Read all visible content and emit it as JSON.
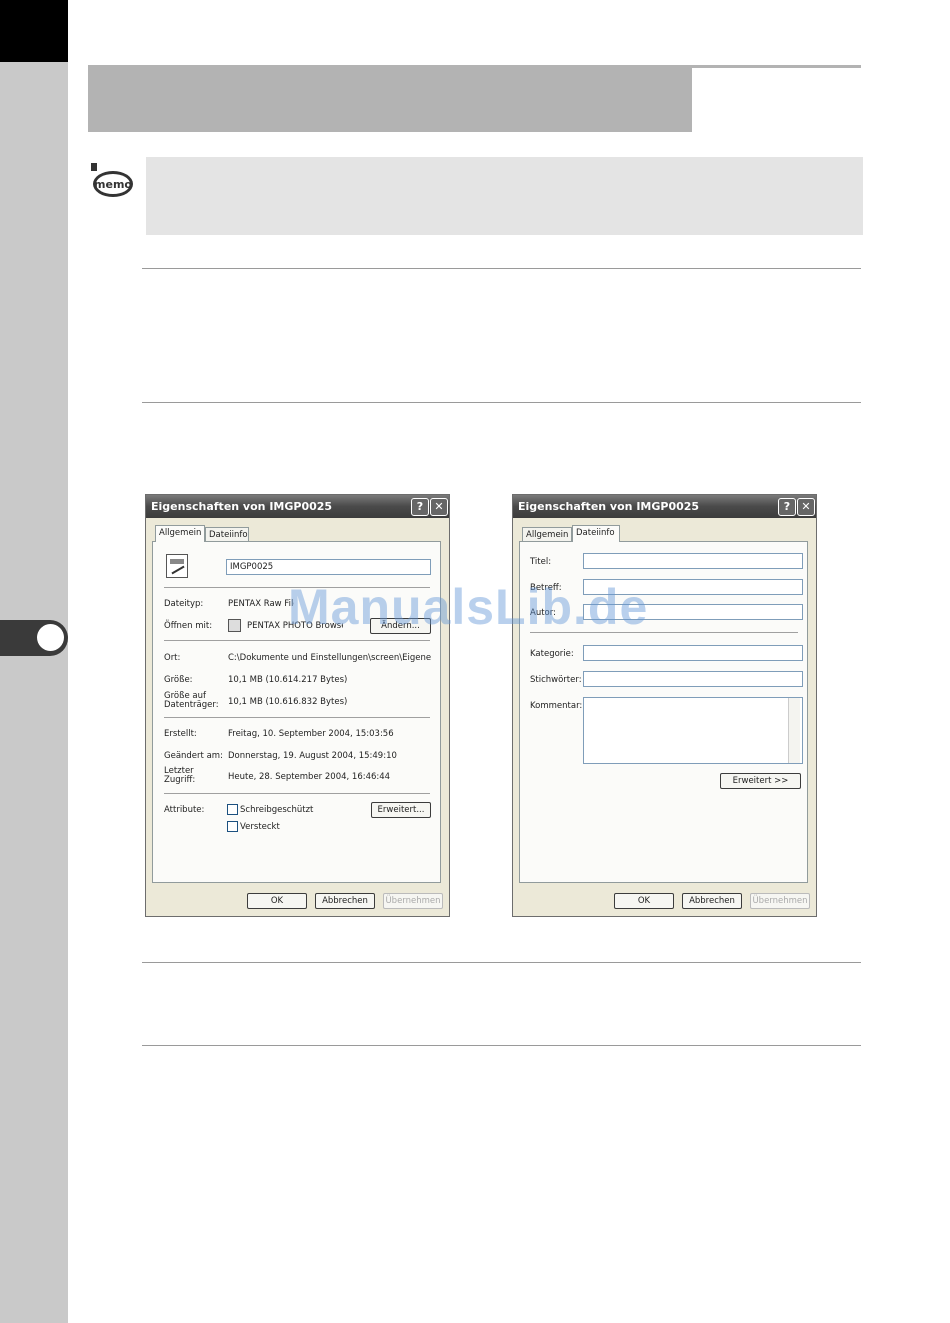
{
  "watermark": "ManualsLib.de",
  "memo": {
    "icon_text": "memo"
  },
  "dialog_left": {
    "title": "Eigenschaften von IMGP0025",
    "help_btn": "?",
    "close_btn": "✕",
    "tabs": [
      "Allgemein",
      "Dateiinfo"
    ],
    "file_name": "IMGP0025",
    "rows": [
      {
        "label": "Dateityp:",
        "value": "PENTAX Raw File"
      },
      {
        "label": "Öffnen mit:",
        "value": "PENTAX PHOTO Browser"
      },
      {
        "label": "Ort:",
        "value": "C:\\Dokumente und Einstellungen\\screen\\Eigene Da"
      },
      {
        "label": "Größe:",
        "value": "10,1 MB (10.614.217 Bytes)"
      },
      {
        "label": "Größe auf Datenträger:",
        "value": "10,1 MB (10.616.832 Bytes)"
      },
      {
        "label": "Erstellt:",
        "value": "Freitag, 10. September 2004, 15:03:56"
      },
      {
        "label": "Geändert am:",
        "value": "Donnerstag, 19. August 2004, 15:49:10"
      },
      {
        "label": "Letzter Zugriff:",
        "value": "Heute, 28. September 2004, 16:46:44"
      }
    ],
    "change_button": "Ändern...",
    "attributes_label": "Attribute:",
    "readonly_label": "Schreibgeschützt",
    "hidden_label": "Versteckt",
    "advanced_button": "Erweitert...",
    "ok": "OK",
    "cancel": "Abbrechen",
    "apply": "Übernehmen"
  },
  "dialog_right": {
    "title": "Eigenschaften von IMGP0025",
    "help_btn": "?",
    "close_btn": "✕",
    "tabs": [
      "Allgemein",
      "Dateiinfo"
    ],
    "fields": [
      "Titel:",
      "Betreff:",
      "Autor:",
      "Kategorie:",
      "Stichwörter:",
      "Kommentar:"
    ],
    "advanced_button": "Erweitert >>",
    "ok": "OK",
    "cancel": "Abbrechen",
    "apply": "Übernehmen"
  }
}
